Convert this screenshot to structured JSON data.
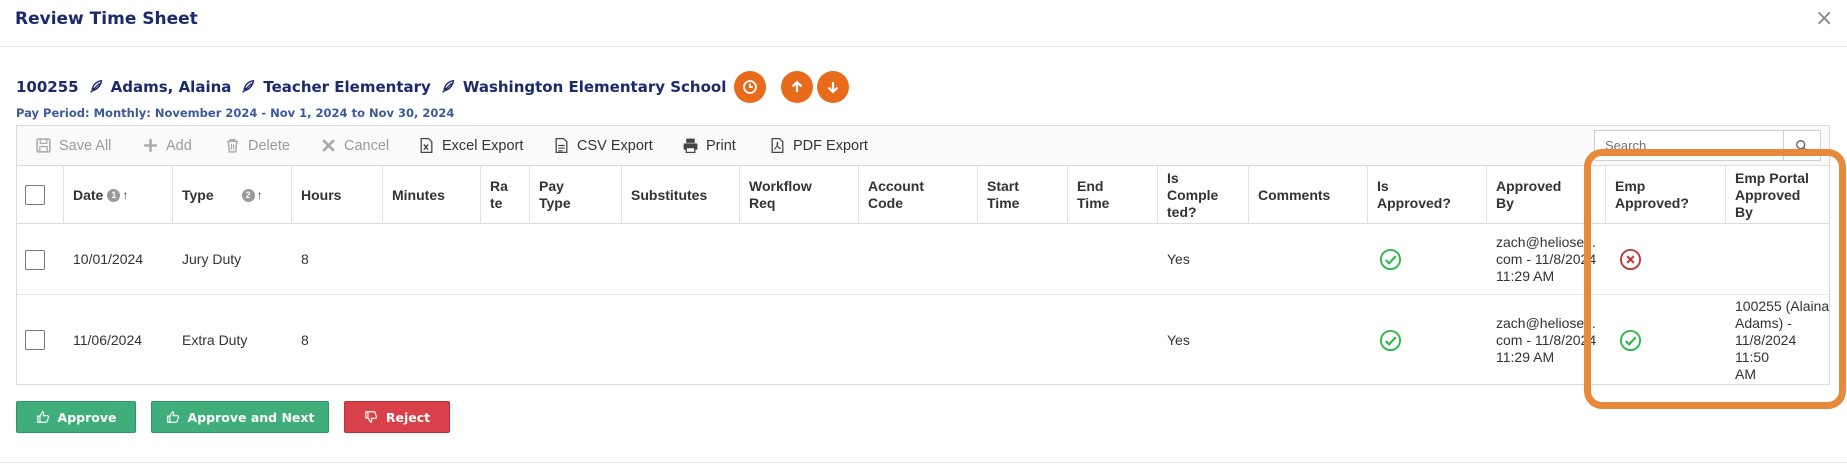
{
  "modal": {
    "title": "Review Time Sheet",
    "close": "×"
  },
  "employee": {
    "id": "100255",
    "name": "Adams, Alaina",
    "position": "Teacher Elementary",
    "school": "Washington Elementary School",
    "pay_period": "Pay Period: Monthly: November 2024 - Nov 1, 2024 to Nov 30, 2024"
  },
  "toolbar": {
    "save_all": "Save All",
    "add": "Add",
    "delete": "Delete",
    "cancel": "Cancel",
    "excel_export": "Excel Export",
    "csv_export": "CSV Export",
    "print": "Print",
    "pdf_export": "PDF Export",
    "search_placeholder": "Search"
  },
  "columns": {
    "date": "Date",
    "date_sort": "1",
    "type": "Type",
    "type_sort": "2",
    "hours": "Hours",
    "minutes": "Minutes",
    "rate": "Ra\nte",
    "pay_type": "Pay\nType",
    "substitutes": "Substitutes",
    "workflow_req": "Workflow\nReq",
    "account_code": "Account\nCode",
    "start_time": "Start\nTime",
    "end_time": "End\nTime",
    "is_completed": "Is\nComple\nted?",
    "comments": "Comments",
    "is_approved": "Is\nApproved?",
    "approved_by": "Approved\nBy",
    "emp_approved": "Emp\nApproved?",
    "emp_portal_approved_by": "Emp Portal\nApproved\nBy"
  },
  "rows": [
    {
      "date": "10/01/2024",
      "type": "Jury Duty",
      "hours": "8",
      "is_completed": "Yes",
      "is_approved": "approved",
      "approved_by": "zach@heliosed.\ncom - 11/8/2024\n11:29 AM",
      "emp_approved": "rejected",
      "emp_portal_approved_by": ""
    },
    {
      "date": "11/06/2024",
      "type": "Extra Duty",
      "hours": "8",
      "is_completed": "Yes",
      "is_approved": "approved",
      "approved_by": "zach@heliosed.\ncom - 11/8/2024\n11:29 AM",
      "emp_approved": "approved",
      "emp_portal_approved_by": "100255 (Alaina\nAdams) -\n11/8/2024 11:50\nAM"
    }
  ],
  "actions": {
    "approve": "Approve",
    "approve_next": "Approve and Next",
    "reject": "Reject"
  },
  "colors": {
    "title": "#1b2a6b",
    "accent_orange": "#e86a1a",
    "highlight": "#e8893a",
    "green": "#3fae7a",
    "red": "#d9404a",
    "check_green": "#2eb84a",
    "reject_red": "#c0393b"
  }
}
